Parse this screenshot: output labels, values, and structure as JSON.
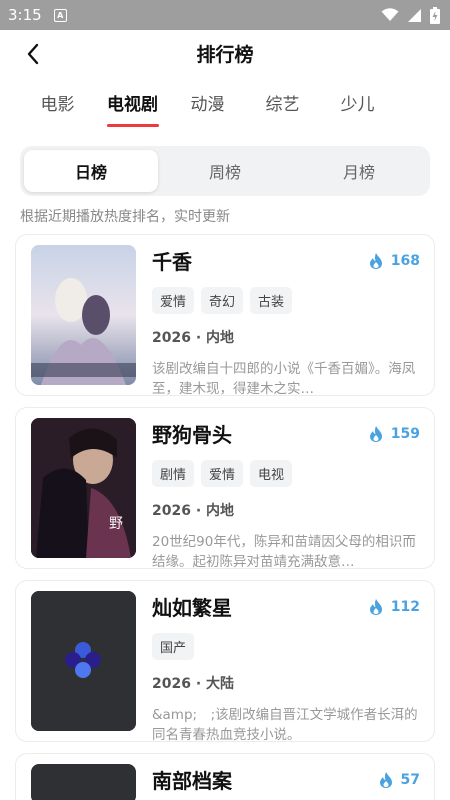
{
  "status": {
    "time": "3:15",
    "notif_icon": "A"
  },
  "header": {
    "title": "排行榜"
  },
  "categories": [
    {
      "label": "电影"
    },
    {
      "label": "电视剧"
    },
    {
      "label": "动漫"
    },
    {
      "label": "综艺"
    },
    {
      "label": "少儿"
    }
  ],
  "active_category": "电视剧",
  "segments": [
    {
      "label": "日榜"
    },
    {
      "label": "周榜"
    },
    {
      "label": "月榜"
    }
  ],
  "active_segment": "日榜",
  "hint": "根据近期播放热度排名，实时更新",
  "items": [
    {
      "title": "千香",
      "heat": "168",
      "tags": [
        "爱情",
        "奇幻",
        "古装"
      ],
      "meta": "2026 · 内地",
      "desc": "该剧改编自十四郎的小说《千香百媚》。海凤至，建木现，得建木之实…"
    },
    {
      "title": "野狗骨头",
      "heat": "159",
      "tags": [
        "剧情",
        "爱情",
        "电视"
      ],
      "meta": "2026 · 内地",
      "desc": "20世纪90年代，陈异和苗靖因父母的相识而结缘。起初陈异对苗靖充满敌意…"
    },
    {
      "title": "灿如繁星",
      "heat": "112",
      "tags": [
        "国产"
      ],
      "meta": "2026 · 大陆",
      "desc": "&amp;　;该剧改编自晋江文学城作者长洱的同名青春热血竞技小说。"
    },
    {
      "title": "南部档案",
      "heat": "57",
      "tags": [],
      "meta": "",
      "desc": ""
    }
  ],
  "colors": {
    "accent": "#ee3a3a",
    "heat": "#4aa3e0",
    "status_bar": "#9e9e9e"
  }
}
